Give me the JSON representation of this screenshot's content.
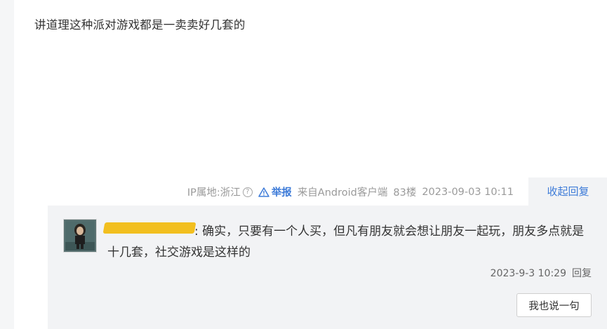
{
  "post": {
    "text": "讲道理这种派对游戏都是一卖卖好几套的",
    "meta": {
      "ip_label": "IP属地:浙江",
      "report_label": "举报",
      "source": "来自Android客户端",
      "floor": "83楼",
      "timestamp": "2023-09-03 10:11"
    },
    "collapse_label": "收起回复"
  },
  "reply": {
    "text": ": 确实，只要有一个人买，但凡有朋友就会想让朋友一起玩，朋友多点就是十几套，社交游戏是这样的",
    "timestamp": "2023-9-3 10:29",
    "reply_label": "回复",
    "say_button": "我也说一句"
  },
  "colors": {
    "link": "#3d7bd8",
    "muted": "#9a9a9a",
    "reply_bg": "#f2f3f5",
    "redaction": "#f2bf1f"
  },
  "icons": {
    "help": "question-circle-icon",
    "report": "warning-triangle-icon"
  }
}
